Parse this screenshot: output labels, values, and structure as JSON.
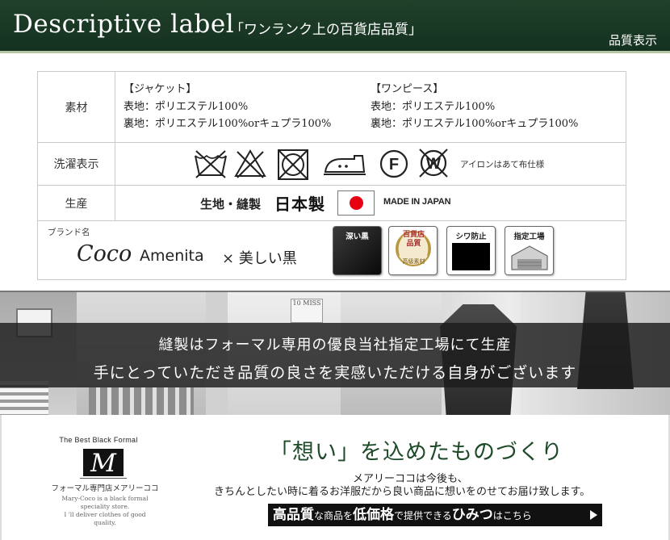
{
  "header": {
    "title": "Descriptive label",
    "catchphrase": "「ワンランク上の百貨店品質」",
    "corner_label": "品質表示"
  },
  "spec": {
    "material": {
      "head": "素材",
      "jacket": {
        "title": "【ジャケット】",
        "outer": "表地：ポリエステル100%",
        "lining": "裏地：ポリエステル100%orキュプラ100%"
      },
      "dress": {
        "title": "【ワンピース】",
        "outer": "表地：ポリエステル100%",
        "lining": "裏地：ポリエステル100%orキュプラ100%"
      }
    },
    "washing": {
      "head": "洗濯表示",
      "icons": [
        "no-wash-icon",
        "no-bleach-icon",
        "no-tumble-dry-icon",
        "iron-icon",
        "dry-clean-f-icon",
        "no-wet-clean-icon"
      ],
      "f_letter": "F",
      "w_letter": "W",
      "note": "アイロンはあて布仕様"
    },
    "origin": {
      "head": "生産",
      "small_text": "生地・縫製",
      "big_text": "日本製",
      "made_in": "MADE IN JAPAN"
    },
    "brand": {
      "label": "ブランド名",
      "coco": "Coco",
      "amenita": "Amenita",
      "rest": "× 美しい黒",
      "badges": [
        {
          "label": "深い黒"
        },
        {
          "label": "百貨店品質",
          "sub": "高級素材"
        },
        {
          "label": "シワ防止"
        },
        {
          "label": "指定工場"
        }
      ]
    }
  },
  "photo_band": {
    "line1": "縫製はフォーマル専用の優良当社指定工場にて生産",
    "line2": "手にとっていただき品質の良さを実感いただける自身がございます",
    "sign": "10 MISS"
  },
  "logo": {
    "tagline": "The Best Black Formal",
    "mark": "M",
    "shop_name": "フォーマル専門店メアリーココ",
    "desc1": "Mary-Coco is a black formal",
    "desc2": "speciality store.",
    "desc3": "I 'll deliver clothes of good",
    "desc4": "quality."
  },
  "main": {
    "title": "「想い」を込めたものづくり",
    "sub1": "メアリーココは今後も、",
    "sub2": "きちんとしたい時に着るお洋服だから良い商品に想いをのせてお届け致します。",
    "cta": {
      "part1": "高品質",
      "part2": "な商品を",
      "part3": "低価格",
      "part4": "で提供できる",
      "part5": "ひみつ",
      "part6": "はこちら"
    }
  }
}
